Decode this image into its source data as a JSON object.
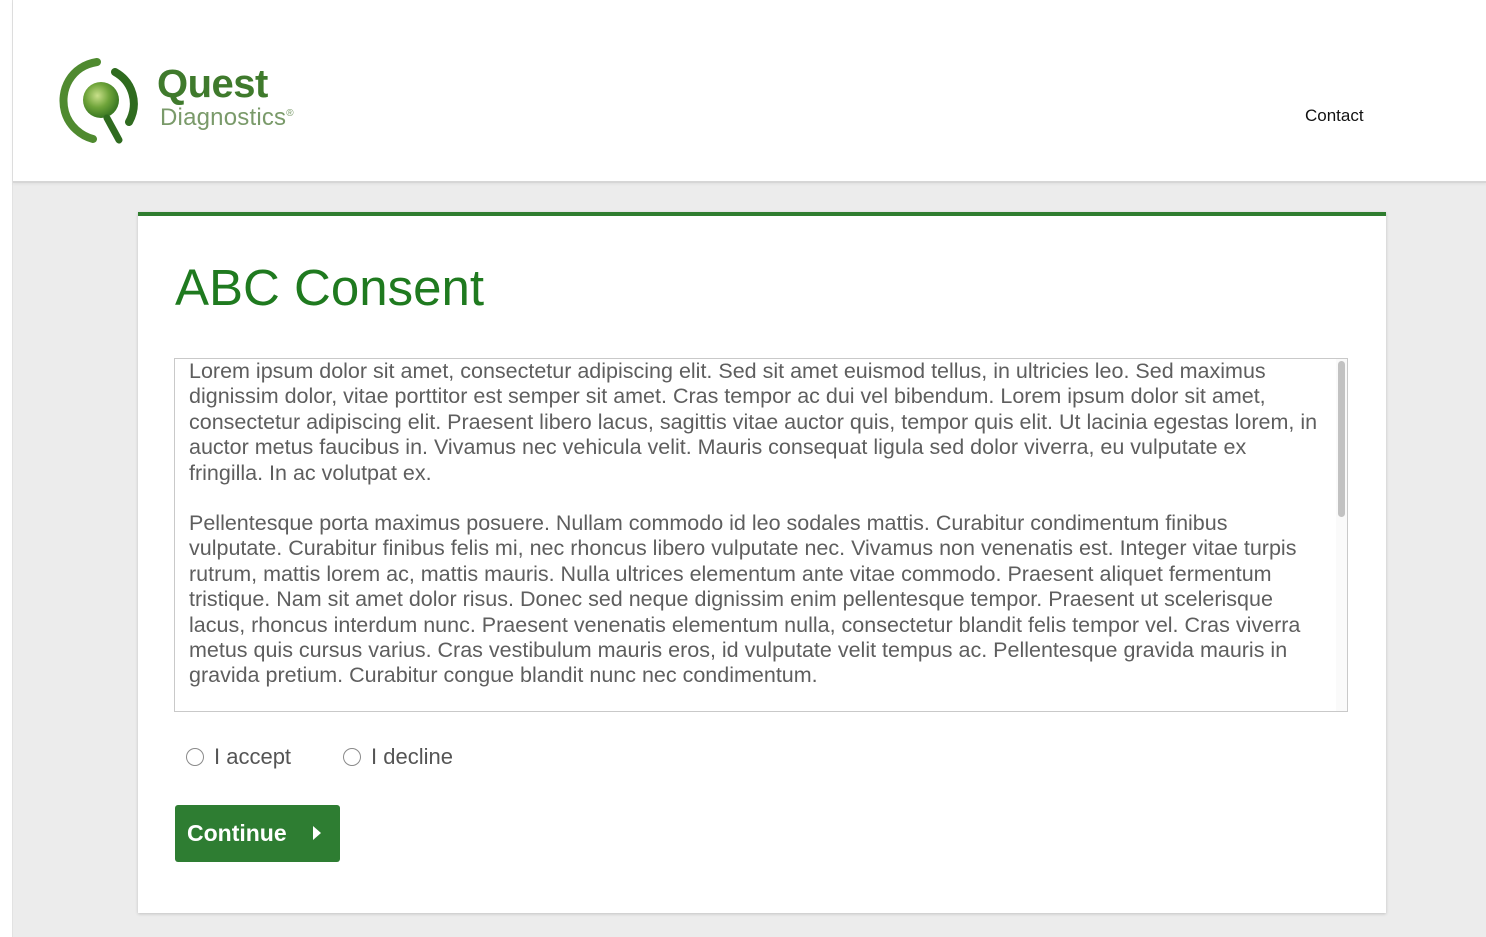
{
  "header": {
    "logo": {
      "word1": "Quest",
      "word2": "Diagnostics",
      "registered_mark": "®",
      "icon": "quest-q-logo-icon"
    },
    "nav": {
      "contact_label": "Contact"
    }
  },
  "card": {
    "title": "ABC Consent",
    "consent_paragraphs": [
      "Lorem ipsum dolor sit amet, consectetur adipiscing elit. Sed sit amet euismod tellus, in ultricies leo. Sed maximus dignissim dolor, vitae porttitor est semper sit amet. Cras tempor ac dui vel bibendum. Lorem ipsum dolor sit amet, consectetur adipiscing elit. Praesent libero lacus, sagittis vitae auctor quis, tempor quis elit. Ut lacinia egestas lorem, in auctor metus faucibus in. Vivamus nec vehicula velit. Mauris consequat ligula sed dolor viverra, eu vulputate ex fringilla. In ac volutpat ex.",
      "Pellentesque porta maximus posuere. Nullam commodo id leo sodales mattis. Curabitur condimentum finibus vulputate. Curabitur finibus felis mi, nec rhoncus libero vulputate nec. Vivamus non venenatis est. Integer vitae turpis rutrum, mattis lorem ac, mattis mauris. Nulla ultrices elementum ante vitae commodo. Praesent aliquet fermentum tristique. Nam sit amet dolor risus. Donec sed neque dignissim enim pellentesque tempor. Praesent ut scelerisque lacus, rhoncus interdum nunc. Praesent venenatis elementum nulla, consectetur blandit felis tempor vel. Cras viverra metus quis cursus varius. Cras vestibulum mauris eros, id vulputate velit tempus ac. Pellentesque gravida mauris in gravida pretium. Curabitur congue blandit nunc nec condimentum."
    ],
    "options": [
      {
        "label": "I accept",
        "selected": false
      },
      {
        "label": "I decline",
        "selected": false
      }
    ],
    "continue_label": "Continue",
    "continue_icon": "chevron-right-icon"
  },
  "colors": {
    "brand_green": "#2e7d32",
    "title_green": "#1f7a1f",
    "logo_green": "#3f7a2c",
    "page_background": "#ececec"
  }
}
